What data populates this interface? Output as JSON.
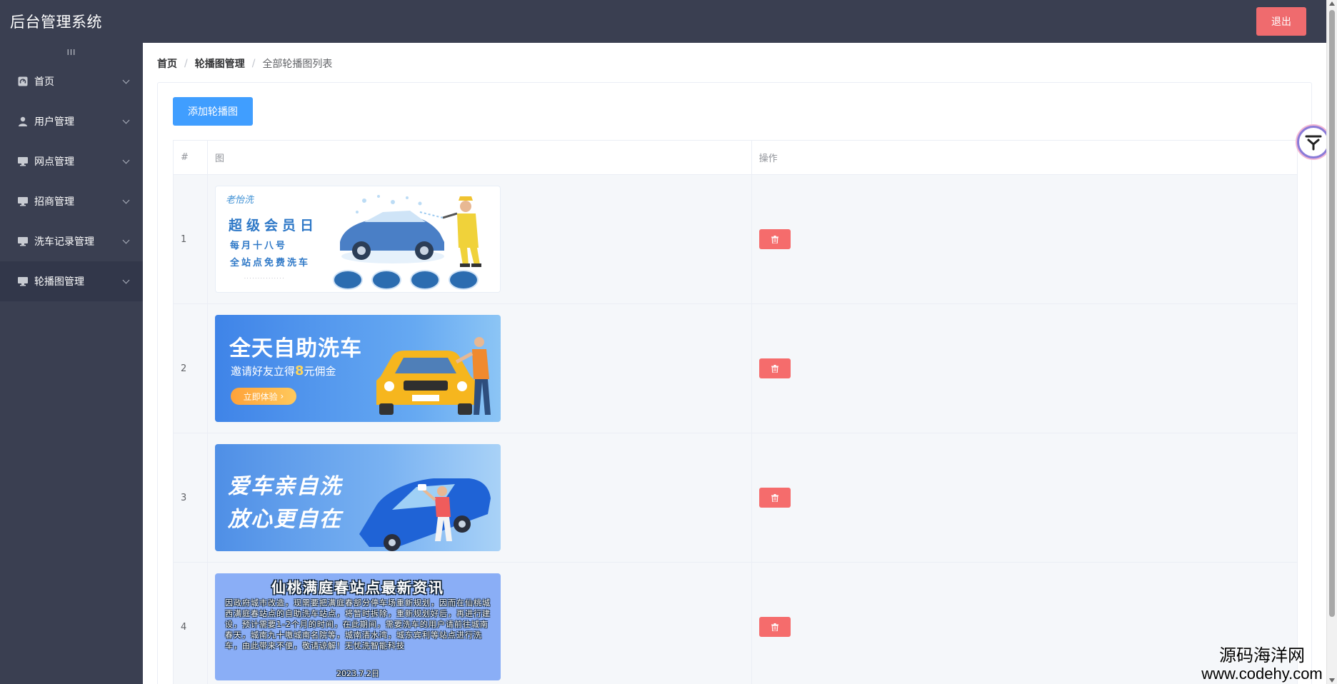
{
  "header": {
    "title": "后台管理系统",
    "logout_label": "退出"
  },
  "sidebar": {
    "toggle_glyph": "III",
    "items": [
      {
        "label": "首页",
        "icon": "dashboard-icon"
      },
      {
        "label": "用户管理",
        "icon": "user-icon"
      },
      {
        "label": "网点管理",
        "icon": "monitor-icon"
      },
      {
        "label": "招商管理",
        "icon": "monitor-icon"
      },
      {
        "label": "洗车记录管理",
        "icon": "monitor-icon"
      },
      {
        "label": "轮播图管理",
        "icon": "monitor-icon",
        "active": true
      }
    ]
  },
  "breadcrumb": {
    "home": "首页",
    "section": "轮播图管理",
    "current": "全部轮播图列表",
    "separator": "/"
  },
  "toolbar": {
    "add_label": "添加轮播图"
  },
  "table": {
    "headers": [
      "#",
      "图",
      "操作"
    ],
    "rows": [
      {
        "index": "1"
      },
      {
        "index": "2"
      },
      {
        "index": "3"
      },
      {
        "index": "4"
      }
    ]
  },
  "banners": {
    "b1": {
      "brand": "老怡洗",
      "line1": "超级会员日",
      "line2": "每月十八号",
      "line3": "全站点免费洗车"
    },
    "b2": {
      "title": "全天自助洗车",
      "sub_prefix": "邀请好友立得",
      "sub_amount": "8",
      "sub_suffix": "元佣金",
      "button": "立即体验"
    },
    "b3": {
      "line1": "爱车亲自洗",
      "line2": "放心更自在"
    },
    "b4": {
      "title": "仙桃满庭春站点最新资讯",
      "body": "因政府城市改造，现需要把满庭春部分停车场重新规划，因而在仙桃城西满庭春站点的自助洗车站点，将暂时拆除，重新规划好后，再进行建设，预计需要1-2个月的时间，在此期间，需要洗车的用户请前往城南春天，城南九十嗷城南名院等，城南清水湾，城东宾利等站点进行洗车，由此带来不便，敬请谅解！无忧洗智能科技",
      "date": "2023.7.2日"
    }
  },
  "watermark": {
    "line1": "源码海洋网",
    "line2": "www.codehy.com"
  },
  "colors": {
    "sidebar_bg": "#3a3f51",
    "primary": "#409eff",
    "danger": "#f56c6c",
    "logout": "#ef6b6e"
  }
}
